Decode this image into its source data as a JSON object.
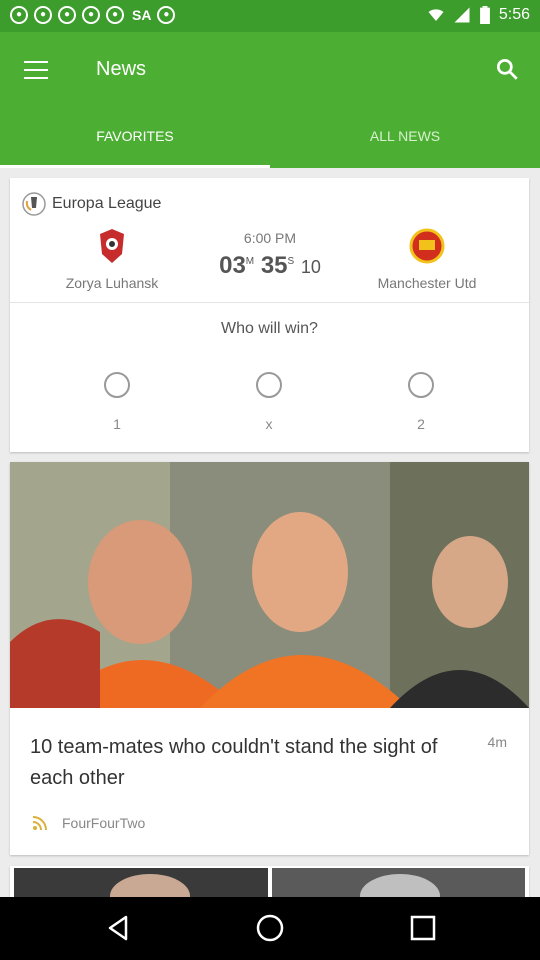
{
  "status_bar": {
    "icons": [
      "soccer-ball-icon",
      "soccer-ball-icon",
      "soccer-ball-icon",
      "soccer-ball-icon",
      "soccer-ball-icon"
    ],
    "carrier_label": "SA",
    "time": "5:56"
  },
  "app_bar": {
    "title": "News",
    "menu_icon": "hamburger-menu-icon",
    "search_icon": "search-icon",
    "tabs": [
      {
        "label": "FAVORITES",
        "active": true
      },
      {
        "label": "ALL NEWS",
        "active": false
      }
    ]
  },
  "match_card": {
    "league": "Europa League",
    "home_team": "Zorya Luhansk",
    "away_team": "Manchester Utd",
    "kickoff_time": "6:00 PM",
    "countdown": {
      "minutes": "03",
      "minutes_unit": "M",
      "seconds": "35",
      "seconds_unit": "S",
      "extra": "10"
    },
    "poll_question": "Who will win?",
    "choices": [
      "1",
      "x",
      "2"
    ]
  },
  "article": {
    "headline": "10 team-mates who couldn't stand the sight of each other",
    "age": "4m",
    "source": "FourFourTwo"
  },
  "colors": {
    "accent": "#4caf34",
    "status_bar": "#3c9c2c"
  }
}
